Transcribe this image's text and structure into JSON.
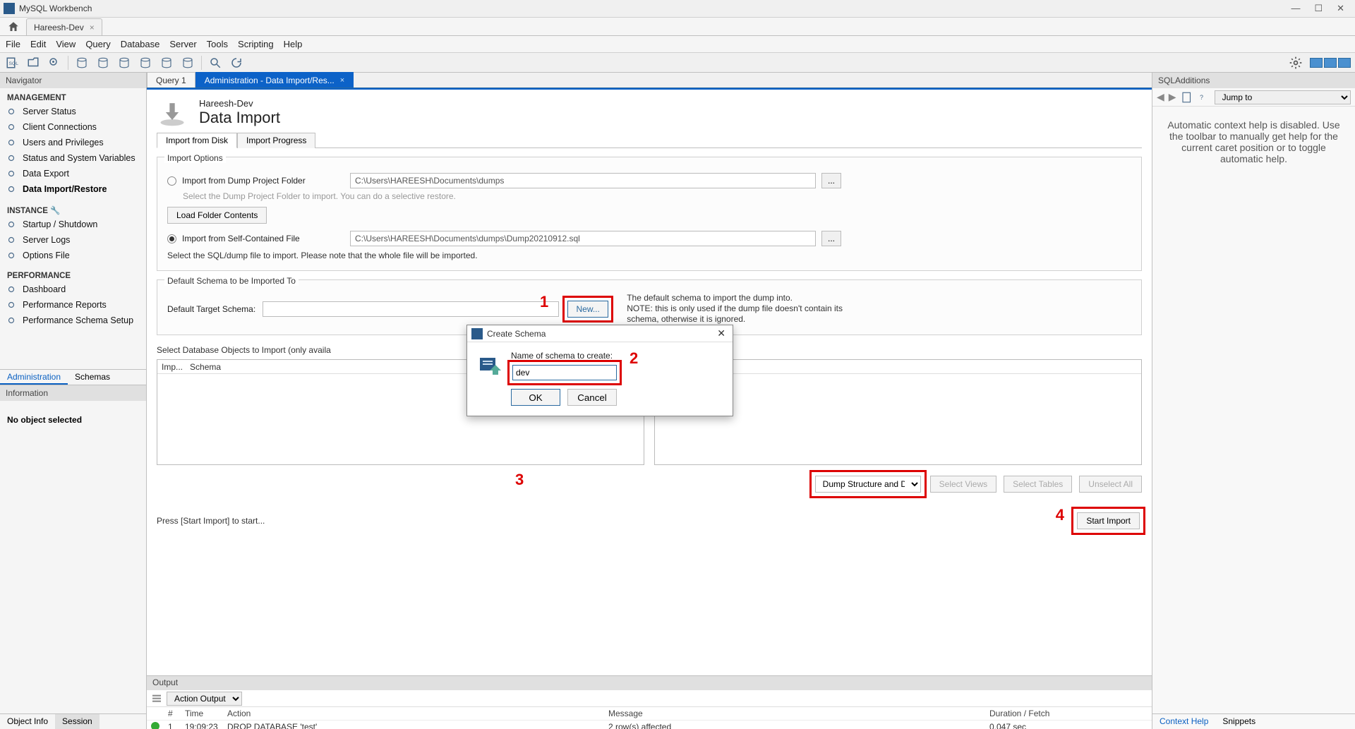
{
  "app": {
    "title": "MySQL Workbench"
  },
  "window_controls": {
    "min": "—",
    "max": "☐",
    "close": "✕"
  },
  "conn_tab": {
    "name": "Hareesh-Dev"
  },
  "menu": [
    "File",
    "Edit",
    "View",
    "Query",
    "Database",
    "Server",
    "Tools",
    "Scripting",
    "Help"
  ],
  "navigator": {
    "title": "Navigator",
    "groups": [
      {
        "title": "MANAGEMENT",
        "items": [
          {
            "icon": "play",
            "label": "Server Status"
          },
          {
            "icon": "users",
            "label": "Client Connections"
          },
          {
            "icon": "privs",
            "label": "Users and Privileges"
          },
          {
            "icon": "vars",
            "label": "Status and System Variables"
          },
          {
            "icon": "export",
            "label": "Data Export"
          },
          {
            "icon": "import",
            "label": "Data Import/Restore",
            "bold": true
          }
        ]
      },
      {
        "title": "INSTANCE 🔧",
        "items": [
          {
            "icon": "power",
            "label": "Startup / Shutdown"
          },
          {
            "icon": "log",
            "label": "Server Logs"
          },
          {
            "icon": "options",
            "label": "Options File"
          }
        ]
      },
      {
        "title": "PERFORMANCE",
        "items": [
          {
            "icon": "dash",
            "label": "Dashboard"
          },
          {
            "icon": "report",
            "label": "Performance Reports"
          },
          {
            "icon": "schema",
            "label": "Performance Schema Setup"
          }
        ]
      }
    ],
    "tabs": [
      "Administration",
      "Schemas"
    ],
    "info_title": "Information",
    "no_object": "No object selected",
    "bottom_tabs": [
      "Object Info",
      "Session"
    ]
  },
  "editor_tabs": [
    {
      "label": "Query 1",
      "active": false
    },
    {
      "label": "Administration - Data Import/Res...",
      "active": true,
      "closable": true
    }
  ],
  "di": {
    "conn": "Hareesh-Dev",
    "title": "Data Import",
    "inner_tabs": [
      "Import from Disk",
      "Import Progress"
    ],
    "options": {
      "group_title": "Import Options",
      "radio1": "Import from Dump Project Folder",
      "path1": "C:\\Users\\HAREESH\\Documents\\dumps",
      "hint1": "Select the Dump Project Folder to import. You can do a selective restore.",
      "load_btn": "Load Folder Contents",
      "radio2": "Import from Self-Contained File",
      "path2": "C:\\Users\\HAREESH\\Documents\\dumps\\Dump20210912.sql",
      "hint2": "Select the SQL/dump file to import. Please note that the whole file will be imported."
    },
    "schema": {
      "group_title": "Default Schema to be Imported To",
      "label": "Default Target Schema:",
      "new_btn": "New...",
      "note": "The default schema to import the dump into.\nNOTE: this is only used if the dump file doesn't contain its schema, otherwise it is ignored."
    },
    "objects": {
      "label": "Select Database Objects to Import (only availa",
      "cols": [
        "Imp...",
        "Schema"
      ],
      "dump_select": "Dump Structure and Dat",
      "select_views": "Select Views",
      "select_tables": "Select Tables",
      "unselect_all": "Unselect All"
    },
    "start": {
      "press": "Press [Start Import] to start...",
      "btn": "Start Import"
    }
  },
  "modal": {
    "title": "Create Schema",
    "label": "Name of schema to create:",
    "value": "dev",
    "ok": "OK",
    "cancel": "Cancel"
  },
  "output": {
    "title": "Output",
    "dropdown": "Action Output",
    "cols": {
      "num": "#",
      "time": "Time",
      "action": "Action",
      "msg": "Message",
      "dur": "Duration / Fetch"
    },
    "row": {
      "num": "1",
      "time": "19:09:23",
      "action": "DROP DATABASE 'test'",
      "msg": "2 row(s) affected",
      "dur": "0.047 sec"
    }
  },
  "sql_add": {
    "title": "SQLAdditions",
    "jump": "Jump to",
    "help": "Automatic context help is disabled. Use the toolbar to manually get help for the current caret position or to toggle automatic help.",
    "tabs": [
      "Context Help",
      "Snippets"
    ]
  },
  "annotations": {
    "n1": "1",
    "n2": "2",
    "n3": "3",
    "n4": "4"
  }
}
